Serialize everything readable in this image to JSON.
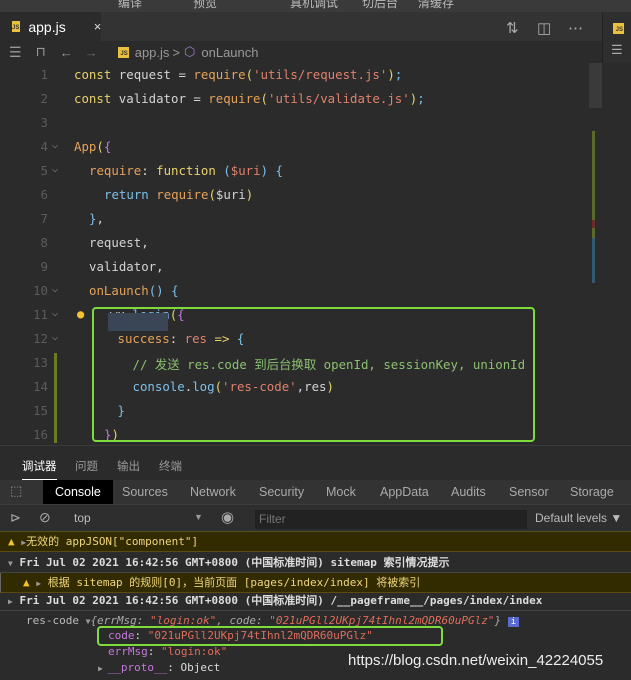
{
  "menubar": {
    "items": [
      "编译",
      "预览",
      "真机调试",
      "切后台",
      "清缓存"
    ]
  },
  "tab": {
    "filename": "app.js",
    "close": "×",
    "icon": "js-file-icon"
  },
  "toolbar_icons": [
    "compare-changes-icon",
    "split-editor-icon",
    "more-icon"
  ],
  "breadcrumb": {
    "file": "app.js",
    "separator": ">",
    "symbol": "onLaunch",
    "symbol_icon": "cube-icon"
  },
  "code": {
    "colors": {
      "kw": "#e8d26c",
      "fn": "#e5a25a",
      "str": "#e0806c",
      "plain": "#d4d4d4",
      "br": "#c678dd",
      "ret": "#7ec0e8",
      "cm": "#8cc070",
      "pu": "#7ec0e8",
      "var": "#e0806c"
    },
    "lines": [
      {
        "n": "1",
        "indent": 0,
        "tokens": [
          [
            "const",
            "kw"
          ],
          [
            " request = ",
            "plain"
          ],
          [
            "require",
            "fn"
          ],
          [
            "(",
            "kw"
          ],
          [
            "'utils/request.js'",
            "str"
          ],
          [
            ")",
            "kw"
          ],
          [
            ";",
            "pu"
          ]
        ]
      },
      {
        "n": "2",
        "indent": 0,
        "tokens": [
          [
            "const",
            "kw"
          ],
          [
            " validator = ",
            "plain"
          ],
          [
            "require",
            "fn"
          ],
          [
            "(",
            "kw"
          ],
          [
            "'utils/validate.js'",
            "str"
          ],
          [
            ")",
            "kw"
          ],
          [
            ";",
            "pu"
          ]
        ]
      },
      {
        "n": "3",
        "indent": 0,
        "tokens": []
      },
      {
        "n": "4",
        "indent": 0,
        "fold": true,
        "tokens": [
          [
            "App",
            "fn"
          ],
          [
            "(",
            "kw"
          ],
          [
            "{",
            "br"
          ]
        ]
      },
      {
        "n": "5",
        "indent": 1,
        "fold": true,
        "tokens": [
          [
            "require",
            "fn"
          ],
          [
            ": ",
            "plain"
          ],
          [
            "function",
            "kw"
          ],
          [
            " (",
            "pu"
          ],
          [
            "$uri",
            "var"
          ],
          [
            ") {",
            "pu"
          ]
        ]
      },
      {
        "n": "6",
        "indent": 2,
        "tokens": [
          [
            "return",
            "ret"
          ],
          [
            " ",
            "plain"
          ],
          [
            "require",
            "fn"
          ],
          [
            "(",
            "kw"
          ],
          [
            "$uri",
            "plain"
          ],
          [
            ")",
            "kw"
          ]
        ]
      },
      {
        "n": "7",
        "indent": 1,
        "tokens": [
          [
            "}",
            "pu"
          ],
          [
            ",",
            "plain"
          ]
        ]
      },
      {
        "n": "8",
        "indent": 1,
        "tokens": [
          [
            "request",
            "plain"
          ],
          [
            ",",
            "plain"
          ]
        ]
      },
      {
        "n": "9",
        "indent": 1,
        "tokens": [
          [
            "validator",
            "plain"
          ],
          [
            ",",
            "plain"
          ]
        ]
      },
      {
        "n": "10",
        "indent": 1,
        "fold": true,
        "tokens": [
          [
            "onLaunch",
            "fn"
          ],
          [
            "() {",
            "pu"
          ]
        ]
      },
      {
        "n": "11",
        "indent": 2.4,
        "fold": true,
        "bulb": true,
        "tokens": [
          [
            "wx",
            "plain"
          ],
          [
            ".",
            "plain"
          ],
          [
            "login",
            "ret"
          ],
          [
            "(",
            "kw"
          ],
          [
            "{",
            "br"
          ]
        ]
      },
      {
        "n": "12",
        "indent": 2.9,
        "fold": true,
        "tokens": [
          [
            "success",
            "fn"
          ],
          [
            ": ",
            "plain"
          ],
          [
            "res",
            "var"
          ],
          [
            " => ",
            "kw"
          ],
          [
            "{",
            "pu"
          ]
        ]
      },
      {
        "n": "13",
        "indent": 3.9,
        "tokens": [
          [
            "// 发送 res.code 到后台换取 openId, sessionKey, unionId",
            "cm"
          ]
        ]
      },
      {
        "n": "14",
        "indent": 3.9,
        "tokens": [
          [
            "console",
            "ret"
          ],
          [
            ".",
            "plain"
          ],
          [
            "log",
            "ret"
          ],
          [
            "(",
            "kw"
          ],
          [
            "'res-code'",
            "str"
          ],
          [
            ",res",
            "plain"
          ],
          [
            ")",
            "kw"
          ]
        ]
      },
      {
        "n": "15",
        "indent": 2.9,
        "tokens": [
          [
            "}",
            "pu"
          ]
        ]
      },
      {
        "n": "16",
        "indent": 2,
        "tokens": [
          [
            "}",
            "br"
          ],
          [
            ")",
            "kw"
          ]
        ]
      }
    ]
  },
  "panel_tabs": [
    "调试器",
    "问题",
    "输出",
    "终端"
  ],
  "devtools_tabs": [
    "Console",
    "Sources",
    "Network",
    "Security",
    "Mock",
    "AppData",
    "Audits",
    "Sensor",
    "Storage"
  ],
  "console_toolbar": {
    "context": "top",
    "filter_placeholder": "Filter",
    "levels": "Default levels ▼"
  },
  "console": {
    "warn1": "无效的 appJSON[\"component\"]",
    "group1": "Fri Jul 02 2021 16:42:56 GMT+0800 (中国标准时间) sitemap 索引情况提示",
    "warn2": "根据 sitemap 的规则[0]，当前页面 [pages/index/index] 将被索引",
    "group2": "Fri Jul 02 2021 16:42:56 GMT+0800 (中国标准时间) /__pageframe__/pages/index/index",
    "log_label": "res-code",
    "summary_prefix": "{errMsg: ",
    "summary_errmsg": "\"login:ok\"",
    "summary_mid": ", code: ",
    "summary_code": "\"021uPGll2UKpj74tIhnl2mQDR60uPGlz\"",
    "summary_end": "}",
    "code_key": "code",
    "code_val": "\"021uPGll2UKpj74tIhnl2mQDR60uPGlz\"",
    "errmsg_key": "errMsg",
    "errmsg_val": "\"login:ok\"",
    "proto_key": "__proto__",
    "proto_val": "Object"
  },
  "watermark": "https://blog.csdn.net/weixin_42224055"
}
